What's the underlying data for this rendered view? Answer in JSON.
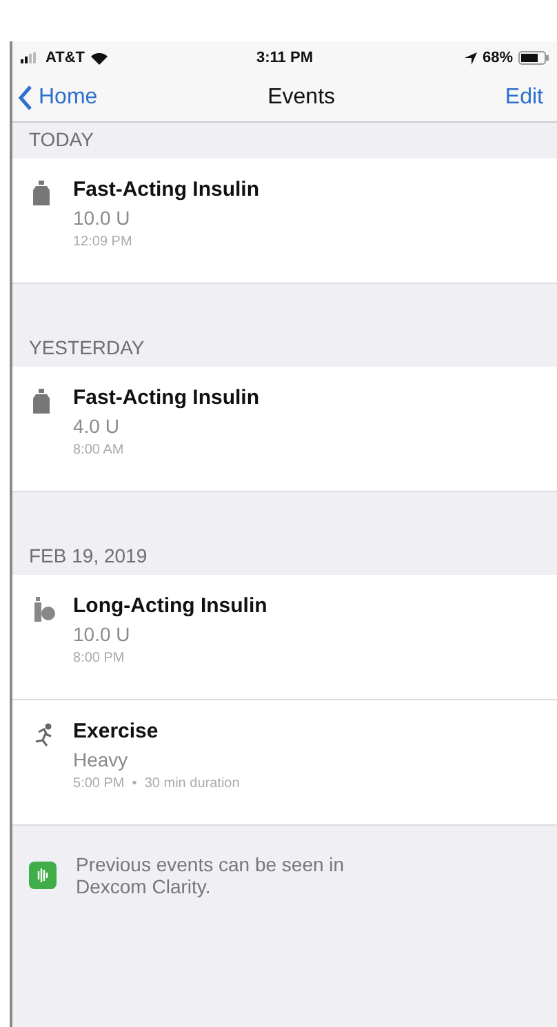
{
  "status_bar": {
    "carrier": "AT&T",
    "time": "3:11 PM",
    "battery": "68%"
  },
  "nav": {
    "back": "Home",
    "title": "Events",
    "action": "Edit"
  },
  "sections": [
    {
      "header": "TODAY",
      "events": [
        {
          "kind": "fast",
          "title": "Fast-Acting Insulin",
          "value": "10.0 U",
          "time": "12:09 PM"
        }
      ]
    },
    {
      "header": "YESTERDAY",
      "events": [
        {
          "kind": "fast",
          "title": "Fast-Acting Insulin",
          "value": "4.0 U",
          "time": "8:00 AM"
        }
      ]
    },
    {
      "header": "FEB 19, 2019",
      "events": [
        {
          "kind": "long",
          "title": "Long-Acting Insulin",
          "value": "10.0 U",
          "time": "8:00 PM"
        },
        {
          "kind": "exercise",
          "title": "Exercise",
          "value": "Heavy",
          "time": "5:00 PM  •  30 min duration"
        }
      ]
    }
  ],
  "footer": {
    "text": "Previous events can be seen in Dexcom Clarity."
  }
}
